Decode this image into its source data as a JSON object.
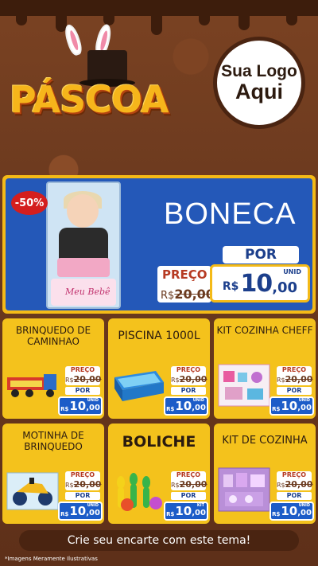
{
  "header": {
    "title": "PÁSCOA",
    "logo_line1": "Sua Logo",
    "logo_line2": "Aqui"
  },
  "hero": {
    "discount": "-50%",
    "product_name": "BONECA",
    "box_brand": "Meu Bebê",
    "por_label": "POR",
    "preco_label": "PREÇO",
    "old_currency": "R$",
    "old_price": "20,00",
    "unid_label": "UNID",
    "currency": "R$",
    "price_int": "10",
    "price_cents": ",00"
  },
  "cards": [
    {
      "name": "BRINQUEDO DE CAMINHAO",
      "preco_label": "PREÇO",
      "old_currency": "R$",
      "old_price": "20,00",
      "por_label": "POR",
      "unid": "UNID",
      "currency": "R$",
      "price_int": "10",
      "price_cents": ",00"
    },
    {
      "name": "PISCINA 1000L",
      "preco_label": "PREÇO",
      "old_currency": "R$",
      "old_price": "20,00",
      "por_label": "POR",
      "unid": "UNID",
      "currency": "R$",
      "price_int": "10",
      "price_cents": ",00"
    },
    {
      "name": "KIT COZINHA CHEFF",
      "preco_label": "PREÇO",
      "old_currency": "R$",
      "old_price": "20,00",
      "por_label": "POR",
      "unid": "UNID",
      "currency": "R$",
      "price_int": "10",
      "price_cents": ",00"
    },
    {
      "name": "MOTINHA DE BRINQUEDO",
      "preco_label": "PREÇO",
      "old_currency": "R$",
      "old_price": "20,00",
      "por_label": "POR",
      "unid": "UNID",
      "currency": "R$",
      "price_int": "10",
      "price_cents": ",00"
    },
    {
      "name": "BOLICHE",
      "preco_label": "PREÇO",
      "old_currency": "R$",
      "old_price": "20,00",
      "por_label": "POR",
      "unid": "KIT",
      "currency": "R$",
      "price_int": "10",
      "price_cents": ",00"
    },
    {
      "name": "KIT DE COZINHA",
      "preco_label": "PREÇO",
      "old_currency": "R$",
      "old_price": "20,00",
      "por_label": "POR",
      "unid": "UNID",
      "currency": "R$",
      "price_int": "10",
      "price_cents": ",00"
    }
  ],
  "footer": {
    "cta": "Crie seu encarte com este tema!",
    "disclaimer": "*Imagens Meramente Ilustrativas"
  },
  "colors": {
    "chocolate": "#6b3a1f",
    "gold": "#f4ba17",
    "blue": "#2458b8",
    "red": "#d41e1e"
  }
}
